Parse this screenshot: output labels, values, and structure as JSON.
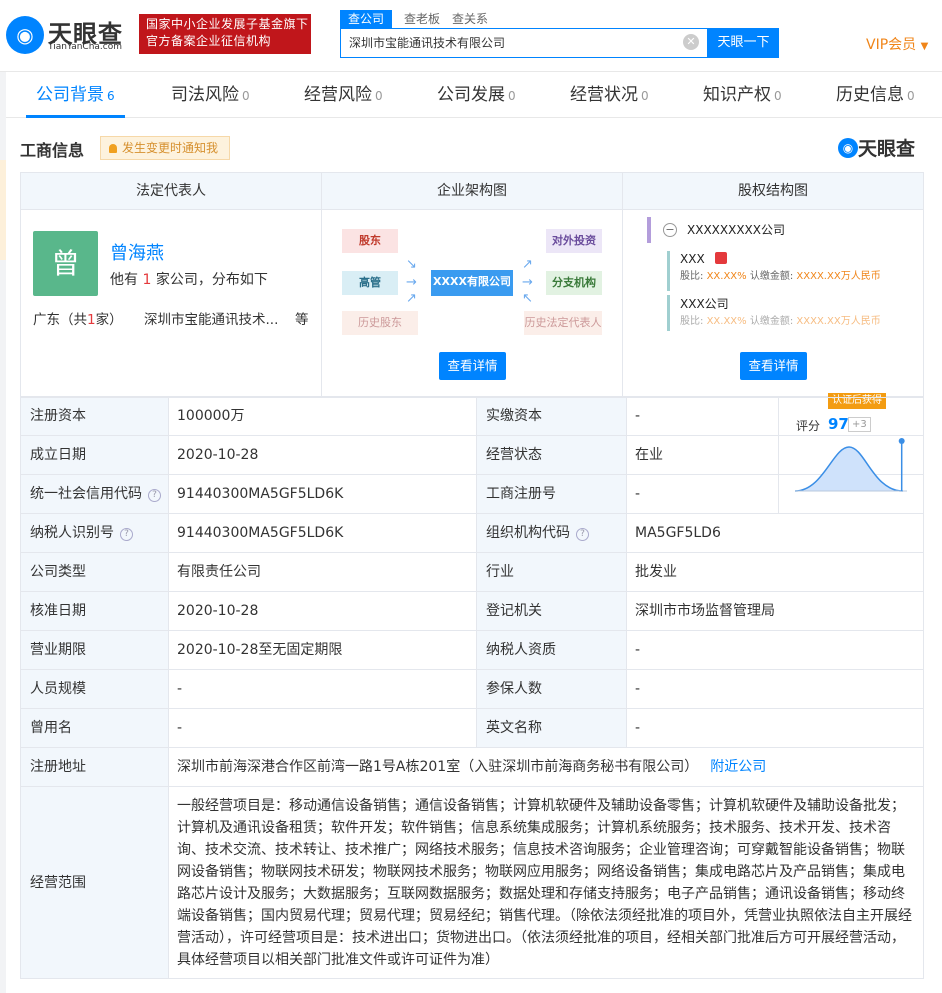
{
  "header": {
    "logo_text": "天眼查",
    "logo_sub": "TianYanCha.com",
    "gov_line1": "国家中小企业发展子基金旗下",
    "gov_line2": "官方备案企业征信机构",
    "search_tabs": [
      "查公司",
      "查老板",
      "查关系"
    ],
    "search_value": "深圳市宝能通讯技术有限公司",
    "search_button": "天眼一下",
    "vip": "VIP会员"
  },
  "nav": {
    "tabs": [
      {
        "label": "公司背景",
        "count": "6"
      },
      {
        "label": "司法风险",
        "count": "0"
      },
      {
        "label": "经营风险",
        "count": "0"
      },
      {
        "label": "公司发展",
        "count": "0"
      },
      {
        "label": "经营状况",
        "count": "0"
      },
      {
        "label": "知识产权",
        "count": "0"
      },
      {
        "label": "历史信息",
        "count": "0"
      }
    ]
  },
  "section": {
    "title": "工商信息",
    "notify_button": "发生变更时通知我",
    "brand": "天眼查"
  },
  "panels": {
    "legal": {
      "header": "法定代表人",
      "avatar_char": "曾",
      "name": "曾海燕",
      "sub_prefix": "他有",
      "sub_count": "1",
      "sub_suffix": "家公司，分布如下",
      "loc_prefix": "广东（共",
      "loc_count": "1",
      "loc_suffix": "家）",
      "company": "深圳市宝能通讯技术...",
      "etc": "等"
    },
    "org": {
      "header": "企业架构图",
      "left_boxes": [
        "股东",
        "高管",
        "历史股东"
      ],
      "center": "XXXX有限公司",
      "right_boxes": [
        "对外投资",
        "分支机构",
        "历史法定代表人"
      ],
      "button": "查看详情"
    },
    "equity": {
      "header": "股权结构图",
      "top": "XXXXXXXXX公司",
      "items": [
        {
          "name": "XXX",
          "ratio_label": "股比:",
          "ratio": "XX.XX%",
          "amount_label": "认缴金额:",
          "amount": "XXXX.XX万人民币"
        },
        {
          "name": "XXX公司",
          "ratio_label": "股比:",
          "ratio": "XX.XX%",
          "amount_label": "认缴金额:",
          "amount": "XXXX.XX万人民币"
        }
      ],
      "button": "查看详情"
    }
  },
  "info": {
    "registered_capital": {
      "label": "注册资本",
      "value": "100000万"
    },
    "paid_capital": {
      "label": "实缴资本",
      "value": "-"
    },
    "founded": {
      "label": "成立日期",
      "value": "2020-10-28"
    },
    "status": {
      "label": "经营状态",
      "value": "在业"
    },
    "credit_code": {
      "label": "统一社会信用代码",
      "value": "91440300MA5GF5LD6K"
    },
    "reg_no": {
      "label": "工商注册号",
      "value": "-"
    },
    "taxpayer_id": {
      "label": "纳税人识别号",
      "value": "91440300MA5GF5LD6K"
    },
    "org_code": {
      "label": "组织机构代码",
      "value": "MA5GF5LD6"
    },
    "company_type": {
      "label": "公司类型",
      "value": "有限责任公司"
    },
    "industry": {
      "label": "行业",
      "value": "批发业"
    },
    "approval_date": {
      "label": "核准日期",
      "value": "2020-10-28"
    },
    "authority": {
      "label": "登记机关",
      "value": "深圳市市场监督管理局"
    },
    "term": {
      "label": "营业期限",
      "value": "2020-10-28至无固定期限"
    },
    "taxpayer_quality": {
      "label": "纳税人资质",
      "value": "-"
    },
    "staff_size": {
      "label": "人员规模",
      "value": "-"
    },
    "insured": {
      "label": "参保人数",
      "value": "-"
    },
    "former_name": {
      "label": "曾用名",
      "value": "-"
    },
    "english_name": {
      "label": "英文名称",
      "value": "-"
    },
    "address": {
      "label": "注册地址",
      "value": "深圳市前海深港合作区前湾一路1号A栋201室（入驻深圳市前海商务秘书有限公司）",
      "link": "附近公司"
    },
    "scope": {
      "label": "经营范围",
      "value": "一般经营项目是：移动通信设备销售；通信设备销售；计算机软硬件及辅助设备零售；计算机软硬件及辅助设备批发；计算机及通讯设备租赁；软件开发；软件销售；信息系统集成服务；计算机系统服务；技术服务、技术开发、技术咨询、技术交流、技术转让、技术推广；网络技术服务；信息技术咨询服务；企业管理咨询；可穿戴智能设备销售；物联网设备销售；物联网技术研发；物联网技术服务；物联网应用服务；网络设备销售；集成电路芯片及产品销售；集成电路芯片设计及服务；大数据服务；互联网数据服务；数据处理和存储支持服务；电子产品销售；通讯设备销售；移动终端设备销售；国内贸易代理；贸易代理；贸易经纪；销售代理。（除依法须经批准的项目外，凭营业执照依法自主开展经营活动），许可经营项目是：技术进出口；货物进出口。（依法须经批准的项目，经相关部门批准后方可开展经营活动，具体经营项目以相关部门批准文件或许可证件为准）"
    }
  },
  "rating": {
    "badge": "认证后获得",
    "label": "评分",
    "score": "97",
    "delta": "+3",
    "percentile": 0.97
  },
  "colors": {
    "accent": "#0084ff",
    "gov_red": "#c0161b",
    "vip_orange": "#f08519",
    "avatar_green": "#59b78b",
    "label_bg": "#f2f7fc"
  }
}
